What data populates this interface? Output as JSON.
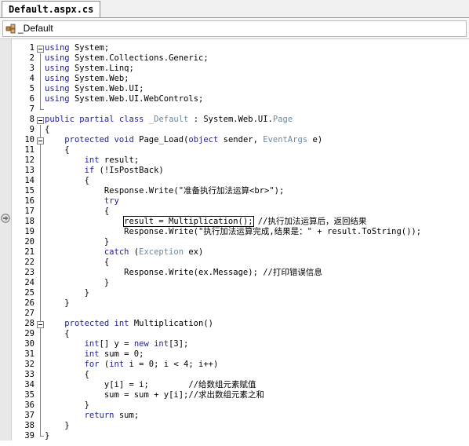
{
  "tab": {
    "label": "Default.aspx.cs"
  },
  "nav": {
    "class_dropdown": "_Default"
  },
  "colors": {
    "keyword": "#2020a0",
    "type": "#6a8aa0",
    "text": "#000000"
  },
  "code_lines": [
    {
      "n": "1",
      "s": "using System;"
    },
    {
      "n": "2",
      "s": "using System.Collections.Generic;"
    },
    {
      "n": "3",
      "s": "using System.Linq;"
    },
    {
      "n": "4",
      "s": "using System.Web;"
    },
    {
      "n": "5",
      "s": "using System.Web.UI;"
    },
    {
      "n": "6",
      "s": "using System.Web.UI.WebControls;"
    },
    {
      "n": "7",
      "s": ""
    },
    {
      "n": "8",
      "s": "public partial class _Default : System.Web.UI.Page"
    },
    {
      "n": "9",
      "s": "{"
    },
    {
      "n": "10",
      "s": "    protected void Page_Load(object sender, EventArgs e)"
    },
    {
      "n": "11",
      "s": "    {"
    },
    {
      "n": "12",
      "s": "        int result;"
    },
    {
      "n": "13",
      "s": "        if (!IsPostBack)"
    },
    {
      "n": "14",
      "s": "        {"
    },
    {
      "n": "15",
      "s": "            Response.Write(\"准备执行加法运算<br>\");"
    },
    {
      "n": "16",
      "s": "            try"
    },
    {
      "n": "17",
      "s": "            {"
    },
    {
      "n": "18",
      "s": "                result = Multiplication(); //执行加法运算后，返回结果"
    },
    {
      "n": "19",
      "s": "                Response.Write(\"执行加法运算完成,结果是：\" + result.ToString());"
    },
    {
      "n": "20",
      "s": "            }"
    },
    {
      "n": "21",
      "s": "            catch (Exception ex)"
    },
    {
      "n": "22",
      "s": "            {"
    },
    {
      "n": "23",
      "s": "                Response.Write(ex.Message); //打印错误信息"
    },
    {
      "n": "24",
      "s": "            }"
    },
    {
      "n": "25",
      "s": "        }"
    },
    {
      "n": "26",
      "s": "    }"
    },
    {
      "n": "27",
      "s": ""
    },
    {
      "n": "28",
      "s": "    protected int Multiplication()"
    },
    {
      "n": "29",
      "s": "    {"
    },
    {
      "n": "30",
      "s": "        int[] y = new int[3];"
    },
    {
      "n": "31",
      "s": "        int sum = 0;"
    },
    {
      "n": "32",
      "s": "        for (int i = 0; i < 4; i++)"
    },
    {
      "n": "33",
      "s": "        {"
    },
    {
      "n": "34",
      "s": "            y[i] = i;        //给数组元素赋值"
    },
    {
      "n": "35",
      "s": "            sum = sum + y[i];//求出数组元素之和"
    },
    {
      "n": "36",
      "s": "        }"
    },
    {
      "n": "37",
      "s": "        return sum;"
    },
    {
      "n": "38",
      "s": "    }"
    },
    {
      "n": "39",
      "s": "}"
    }
  ]
}
